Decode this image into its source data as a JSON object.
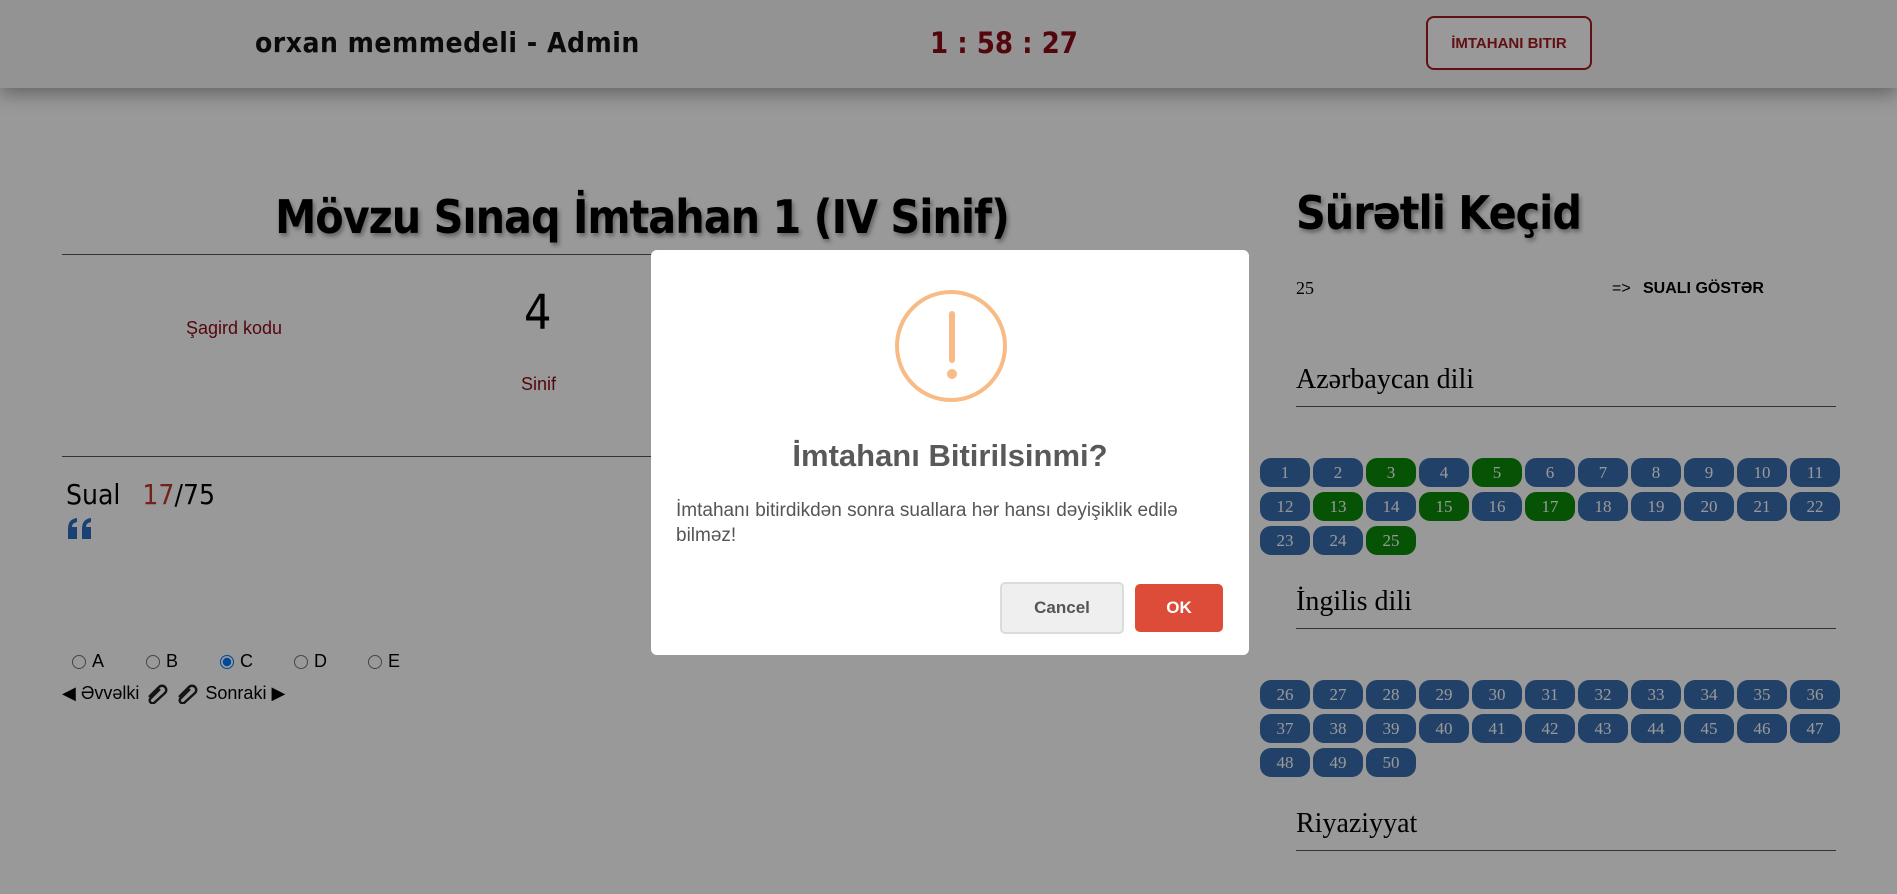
{
  "header": {
    "user": "orxan memmedeli - Admin",
    "timer": "1 : 58 : 27",
    "finish_button": "İMTAHANI BITIR"
  },
  "exam": {
    "title": "Mövzu Sınaq İmtahan 1 (IV Sinif)",
    "student_code_label": "Şagird kodu",
    "grade_value": "4",
    "grade_label": "Sinif"
  },
  "question": {
    "label": "Sual",
    "current": "17",
    "total": "/75",
    "options": [
      "A",
      "B",
      "C",
      "D",
      "E"
    ],
    "selected_option": "C",
    "prev_label": "◀ Əvvəlki",
    "next_label": "Sonraki ▶"
  },
  "sidebar": {
    "title": "Sürətli Keçid",
    "jump_value": "25",
    "jump_arrow": "=>",
    "jump_button": "SUALI GÖSTƏR",
    "subjects": [
      {
        "name": "Azərbaycan dili",
        "questions": [
          "1",
          "2",
          "3",
          "4",
          "5",
          "6",
          "7",
          "8",
          "9",
          "10",
          "11",
          "12",
          "13",
          "14",
          "15",
          "16",
          "17",
          "18",
          "19",
          "20",
          "21",
          "22",
          "23",
          "24",
          "25"
        ],
        "answered": [
          "3",
          "5",
          "13",
          "15",
          "17",
          "25"
        ]
      },
      {
        "name": "İngilis dili",
        "questions": [
          "26",
          "27",
          "28",
          "29",
          "30",
          "31",
          "32",
          "33",
          "34",
          "35",
          "36",
          "37",
          "38",
          "39",
          "40",
          "41",
          "42",
          "43",
          "44",
          "45",
          "46",
          "47",
          "48",
          "49",
          "50"
        ],
        "answered": []
      },
      {
        "name": "Riyaziyyat",
        "questions": [],
        "answered": []
      }
    ]
  },
  "modal": {
    "icon": "exclamation-warning-icon",
    "title": "İmtahanı Bitirilsinmi?",
    "text": "İmtahanı bitirdikdən sonra suallara hər hansı dəyişiklik edilə bilməz!",
    "cancel": "Cancel",
    "ok": "OK"
  },
  "colors": {
    "accent_red": "#8b0a14",
    "pill_blue": "#3a6dae",
    "pill_green": "#0b8a0b",
    "warning": "#f8bb86",
    "ok_button": "#dd4b39"
  }
}
